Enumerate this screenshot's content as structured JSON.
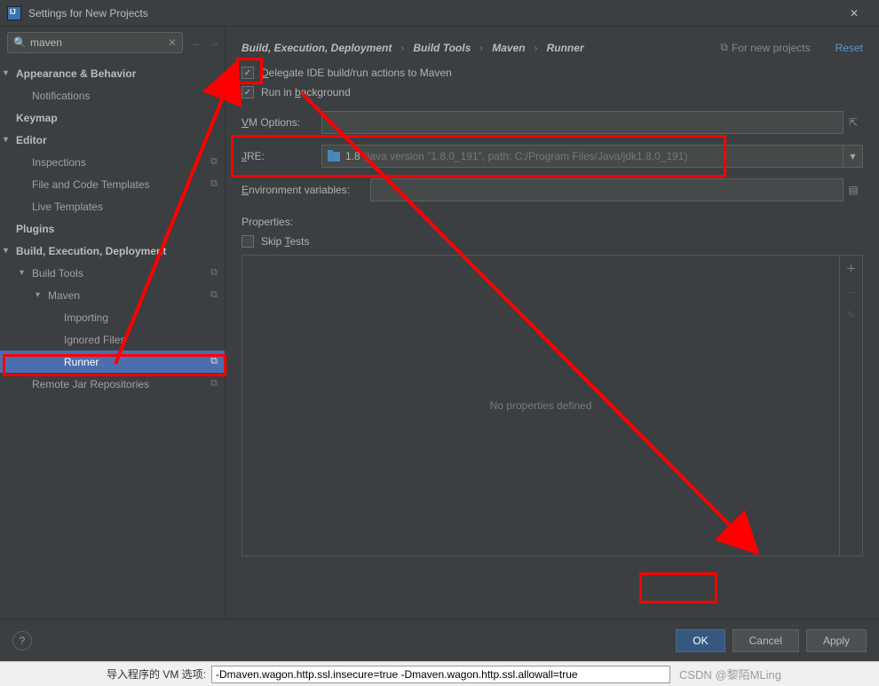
{
  "window": {
    "title": "Settings for New Projects"
  },
  "search": {
    "value": "maven"
  },
  "tree": {
    "appearance": "Appearance & Behavior",
    "notifications": "Notifications",
    "keymap": "Keymap",
    "editor": "Editor",
    "inspections": "Inspections",
    "fileTemplates": "File and Code Templates",
    "liveTemplates": "Live Templates",
    "plugins": "Plugins",
    "bed": "Build, Execution, Deployment",
    "buildTools": "Build Tools",
    "maven": "Maven",
    "importing": "Importing",
    "ignoredFiles": "Ignored Files",
    "runner": "Runner",
    "remoteJar": "Remote Jar Repositories"
  },
  "breadcrumb": {
    "seg1": "Build, Execution, Deployment",
    "seg2": "Build Tools",
    "seg3": "Maven",
    "seg4": "Runner",
    "badge": "For new projects",
    "reset": "Reset"
  },
  "form": {
    "delegate": "Delegate IDE build/run actions to Maven",
    "runInBg": "Run in background",
    "vmOptions": "VM Options:",
    "jreLabel": "JRE:",
    "jreValue": "1.8",
    "jreDetail": "(java version \"1.8.0_191\", path: C:/Program Files/Java/jdk1.8.0_191)",
    "envVars": "Environment variables:"
  },
  "properties": {
    "title": "Properties:",
    "skipTests": "Skip Tests",
    "empty": "No properties defined"
  },
  "buttons": {
    "ok": "OK",
    "cancel": "Cancel",
    "apply": "Apply"
  },
  "strip": {
    "label": "导入程序的 VM 选项:",
    "value": "-Dmaven.wagon.http.ssl.insecure=true -Dmaven.wagon.http.ssl.allowall=true",
    "watermark": "CSDN @黎陌MLing"
  }
}
